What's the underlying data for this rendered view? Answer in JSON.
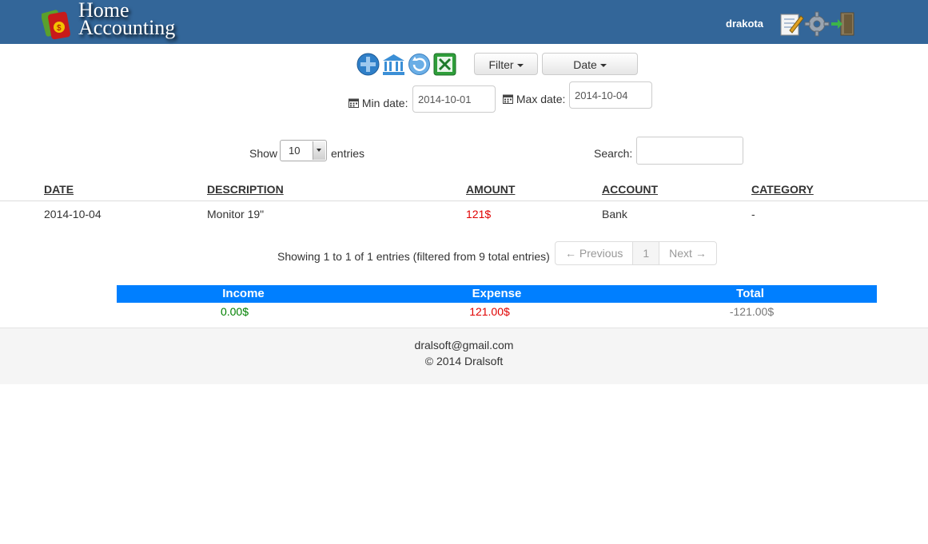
{
  "app": {
    "logo_line1": "Home",
    "logo_line2": "Accounting",
    "user": "drakota",
    "header_icons": [
      "edit-icon",
      "settings-gear-icon",
      "logout-door-icon"
    ]
  },
  "toolbar": {
    "icons": [
      "add-plus-icon",
      "bank-icon",
      "refresh-icon",
      "excel-icon"
    ],
    "filter_label": "Filter",
    "date_label": "Date",
    "min_date_label": "Min date:",
    "min_date_value": "2014-10-01",
    "max_date_label": "Max date:",
    "max_date_value": "2014-10-04"
  },
  "table_controls": {
    "show_label": "Show",
    "entries_value": "10",
    "entries_label": "entries",
    "search_label": "Search:",
    "search_value": ""
  },
  "table": {
    "columns": [
      "DATE",
      "DESCRIPTION",
      "AMOUNT",
      "ACCOUNT",
      "CATEGORY"
    ],
    "rows": [
      {
        "date": "2014-10-04",
        "description": "Monitor 19\"",
        "amount": "121$",
        "account": "Bank",
        "category": "-"
      }
    ],
    "amount_color": "#e00000"
  },
  "pagination": {
    "info": "Showing 1 to 1 of 1 entries (filtered from 9 total entries)",
    "previous": "← Previous",
    "page": "1",
    "next": "Next →"
  },
  "summary": {
    "income_label": "Income",
    "expense_label": "Expense",
    "total_label": "Total",
    "income_value": "0.00$",
    "expense_value": "121.00$",
    "total_value": "-121.00$",
    "header_color": "#007fff",
    "income_color": "#008000",
    "expense_color": "#e00000",
    "total_color": "#777777"
  },
  "footer": {
    "email": "dralsoft@gmail.com",
    "copyright": "© 2014 Dralsoft"
  }
}
